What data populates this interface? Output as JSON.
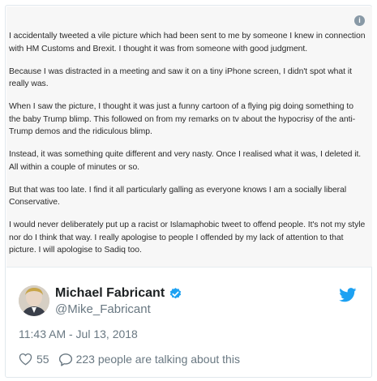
{
  "statement": {
    "paragraphs": [
      "I accidentally tweeted a vile picture which had been sent to me by someone I knew in connection with HM Customs and Brexit. I thought it was from someone with good judgment.",
      "Because I was distracted in a meeting and saw it on a tiny iPhone screen, I didn't spot what it really was.",
      "When I saw the picture, I thought it was just a funny cartoon of a flying pig doing something to the baby Trump blimp. This followed on from my remarks on tv about the hypocrisy of the anti-Trump demos and the ridiculous blimp.",
      "Instead, it was something quite different and very nasty. Once I realised what it was, I deleted it. All within a couple of minutes or so.",
      "But that was too late. I find it all particularly galling as everyone knows I am a socially liberal Conservative.",
      "I would never deliberately put up a racist or Islamaphobic tweet to offend people. It's not my style nor do I think that way. I really apologise to people I offended by my lack of attention to that picture.  I will apologise to Sadiq too."
    ],
    "info_icon": "info-icon"
  },
  "author": {
    "name": "Michael Fabricant",
    "handle": "@Mike_Fabricant",
    "verified_icon": "verified-badge-icon",
    "avatar": "profile-photo"
  },
  "brand_icon": "twitter-bird-icon",
  "timestamp": "11:43 AM - Jul 13, 2018",
  "actions": {
    "like_count": "55",
    "talking_text": "223 people are talking about this",
    "like_icon": "heart-icon",
    "reply_icon": "speech-bubble-icon"
  },
  "colors": {
    "twitter_blue": "#1da1f2",
    "secondary_text": "#697882",
    "border": "#e1e8ed"
  }
}
